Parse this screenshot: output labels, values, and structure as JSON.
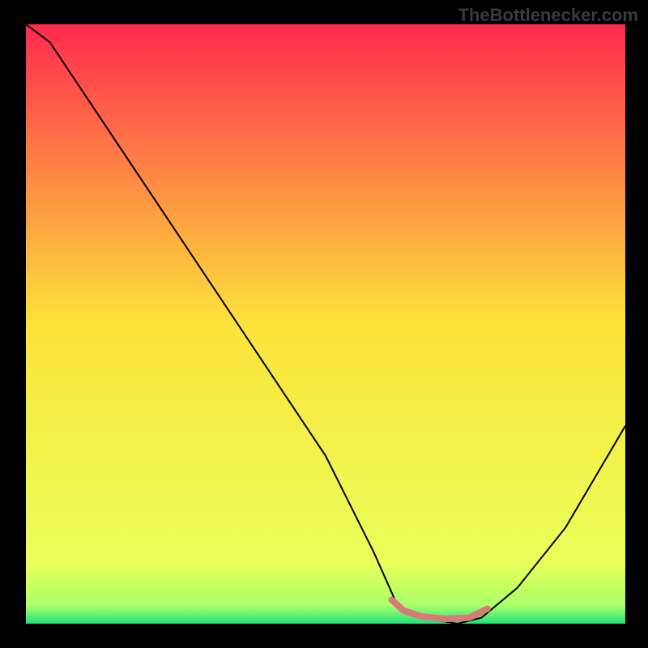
{
  "watermark": "TheBottlenecker.com",
  "chart_data": {
    "type": "line",
    "title": "",
    "xlabel": "",
    "ylabel": "",
    "xlim": [
      0,
      100
    ],
    "ylim": [
      0,
      100
    ],
    "background_gradient": {
      "style": "vertical",
      "stops": [
        {
          "pos": 0.0,
          "color": "#ff2a4e"
        },
        {
          "pos": 0.5,
          "color": "#fce33a"
        },
        {
          "pos": 0.9,
          "color": "#e9ff5a"
        },
        {
          "pos": 0.97,
          "color": "#a9ff6a"
        },
        {
          "pos": 1.0,
          "color": "#1ee27a"
        }
      ]
    },
    "series": [
      {
        "name": "bottleneck-curve",
        "color": "#000000",
        "width": 2,
        "x": [
          0,
          4,
          10,
          20,
          30,
          40,
          50,
          58,
          62,
          66,
          72,
          76,
          82,
          90,
          100
        ],
        "values": [
          100,
          97,
          88,
          73,
          58,
          43,
          28,
          12,
          3,
          1,
          0,
          1,
          6,
          16,
          33
        ]
      }
    ],
    "highlight": {
      "name": "optimal-range",
      "color": "#d97a78",
      "width": 8,
      "x": [
        61,
        63,
        66,
        70,
        74,
        77
      ],
      "values": [
        4,
        2.2,
        1.2,
        0.8,
        1.0,
        2.5
      ]
    }
  }
}
